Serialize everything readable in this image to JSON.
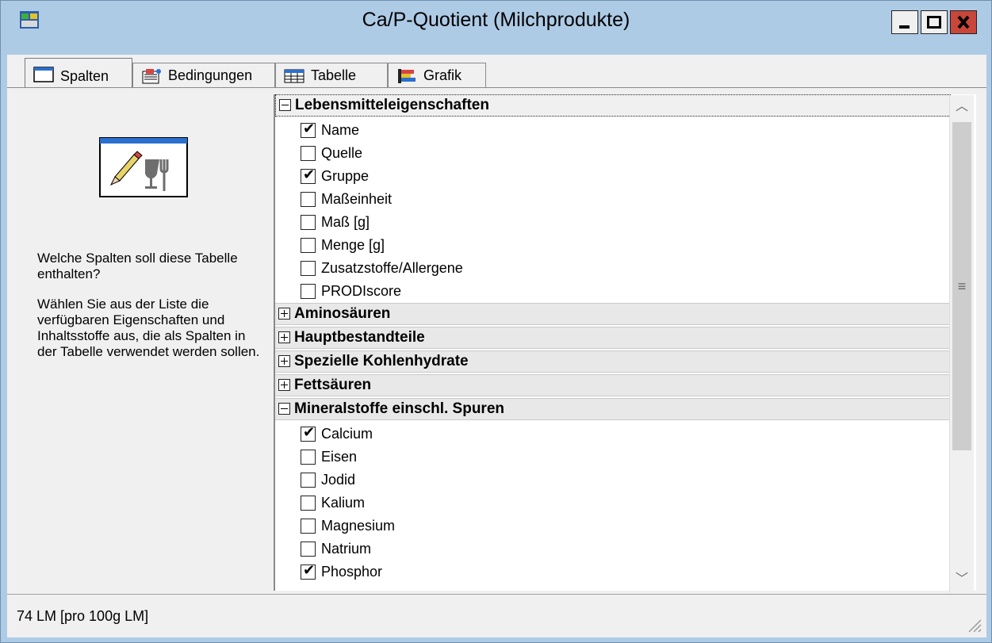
{
  "window": {
    "title": "Ca/P-Quotient (Milchprodukte)"
  },
  "tabs": [
    {
      "label": "Spalten",
      "icon": "window-icon",
      "active": true
    },
    {
      "label": "Bedingungen",
      "icon": "conditions-icon",
      "active": false
    },
    {
      "label": "Tabelle",
      "icon": "table-icon",
      "active": false
    },
    {
      "label": "Grafik",
      "icon": "chart-icon",
      "active": false
    }
  ],
  "left_panel": {
    "question": "Welche Spalten soll diese Tabelle enthalten?",
    "instructions": "Wählen Sie aus der Liste die verfügbaren Eigenschaften und Inhaltsstoffe aus, die als Spalten in der Tabelle verwendet werden sollen."
  },
  "groups": [
    {
      "label": "Lebensmitteleigenschaften",
      "expanded": true,
      "items": [
        {
          "label": "Name",
          "checked": true
        },
        {
          "label": "Quelle",
          "checked": false
        },
        {
          "label": "Gruppe",
          "checked": true
        },
        {
          "label": "Maßeinheit",
          "checked": false
        },
        {
          "label": "Maß [g]",
          "checked": false
        },
        {
          "label": "Menge [g]",
          "checked": false
        },
        {
          "label": "Zusatzstoffe/Allergene",
          "checked": false
        },
        {
          "label": "PRODIscore",
          "checked": false
        }
      ]
    },
    {
      "label": "Aminosäuren",
      "expanded": false,
      "items": []
    },
    {
      "label": "Hauptbestandteile",
      "expanded": false,
      "items": []
    },
    {
      "label": "Spezielle Kohlenhydrate",
      "expanded": false,
      "items": []
    },
    {
      "label": "Fettsäuren",
      "expanded": false,
      "items": []
    },
    {
      "label": "Mineralstoffe einschl. Spuren",
      "expanded": true,
      "items": [
        {
          "label": "Calcium",
          "checked": true
        },
        {
          "label": "Eisen",
          "checked": false
        },
        {
          "label": "Jodid",
          "checked": false
        },
        {
          "label": "Kalium",
          "checked": false
        },
        {
          "label": "Magnesium",
          "checked": false
        },
        {
          "label": "Natrium",
          "checked": false
        },
        {
          "label": "Phosphor",
          "checked": true
        }
      ]
    }
  ],
  "status": {
    "text": "74 LM [pro 100g LM]"
  }
}
